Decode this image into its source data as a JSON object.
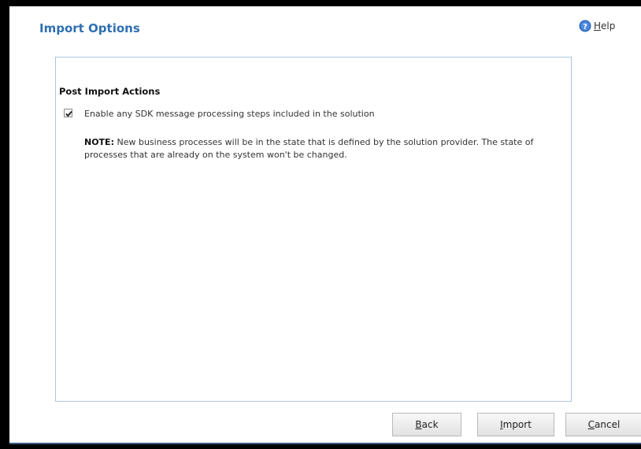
{
  "header": {
    "title": "Import Options",
    "help_label": "Help",
    "help_accel": "H",
    "help_rest": "elp"
  },
  "section": {
    "heading": "Post Import Actions",
    "checkbox_label": "Enable any SDK message processing steps included in the solution",
    "checkbox_checked": true,
    "note_prefix": "NOTE:",
    "note_text": " New business processes will be in the state that is defined by the solution provider. The state of processes that are already on the system won't be changed."
  },
  "buttons": {
    "back": {
      "label": "Back",
      "accel": "B",
      "rest": "ack"
    },
    "import": {
      "label": "Import",
      "accel": "I",
      "rest": "mport"
    },
    "cancel": {
      "label": "Cancel",
      "accel": "C",
      "rest": "ancel"
    }
  },
  "colors": {
    "title": "#2f6fb1",
    "panel_border": "#aec6dc",
    "help_icon": "#2b66b8"
  },
  "icons": {
    "help": "help-icon",
    "checkbox": "checkmark-icon"
  }
}
